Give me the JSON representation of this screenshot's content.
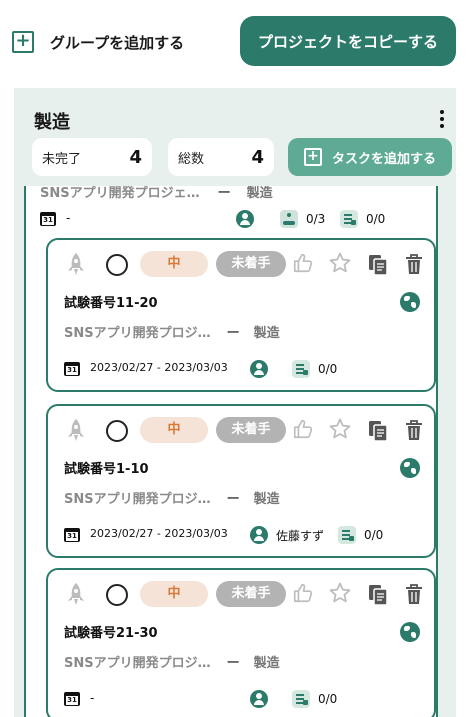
{
  "header": {
    "add_group_label": "グループを追加する",
    "copy_project_label": "プロジェクトをコピーする"
  },
  "group": {
    "title": "製造",
    "stats": {
      "incomplete_label": "未完了",
      "incomplete_value": "4",
      "total_label": "総数",
      "total_value": "4"
    },
    "add_task_label": "タスクを追加する",
    "parent_task": {
      "project": "SNSアプリ開発プロジェ…",
      "separator": "ー",
      "category": "製造",
      "date": "-",
      "subtasks": "0/3",
      "docs": "0/0"
    },
    "cards": [
      {
        "priority": "中",
        "status": "未着手",
        "title": "試験番号11-20",
        "project": "SNSアプリ開発プロジ…",
        "separator": "ー",
        "category": "製造",
        "date": "2023/02/27 - 2023/03/03",
        "assignee": "",
        "docs": "0/0"
      },
      {
        "priority": "中",
        "status": "未着手",
        "title": "試験番号1-10",
        "project": "SNSアプリ開発プロジ…",
        "separator": "ー",
        "category": "製造",
        "date": "2023/02/27 - 2023/03/03",
        "assignee": "佐藤すず",
        "docs": "0/0"
      },
      {
        "priority": "中",
        "status": "未着手",
        "title": "試験番号21-30",
        "project": "SNSアプリ開発プロジ…",
        "separator": "ー",
        "category": "製造",
        "date": "-",
        "assignee": "",
        "docs": "0/0"
      }
    ]
  },
  "colors": {
    "primary": "#2b7a6a",
    "primary_light": "#5eaa94",
    "group_bg": "#e8f0ed",
    "priority_bg": "#f5e3d7",
    "priority_text": "#d8793a",
    "status_bg": "#b3b3b3"
  },
  "icons": [
    "plus-icon",
    "kebab-menu-icon",
    "calendar-icon",
    "person-icon",
    "subtask-icon",
    "document-icon",
    "rocket-icon",
    "thumbs-up-icon",
    "star-icon",
    "copy-icon",
    "trash-icon",
    "globe-icon"
  ]
}
